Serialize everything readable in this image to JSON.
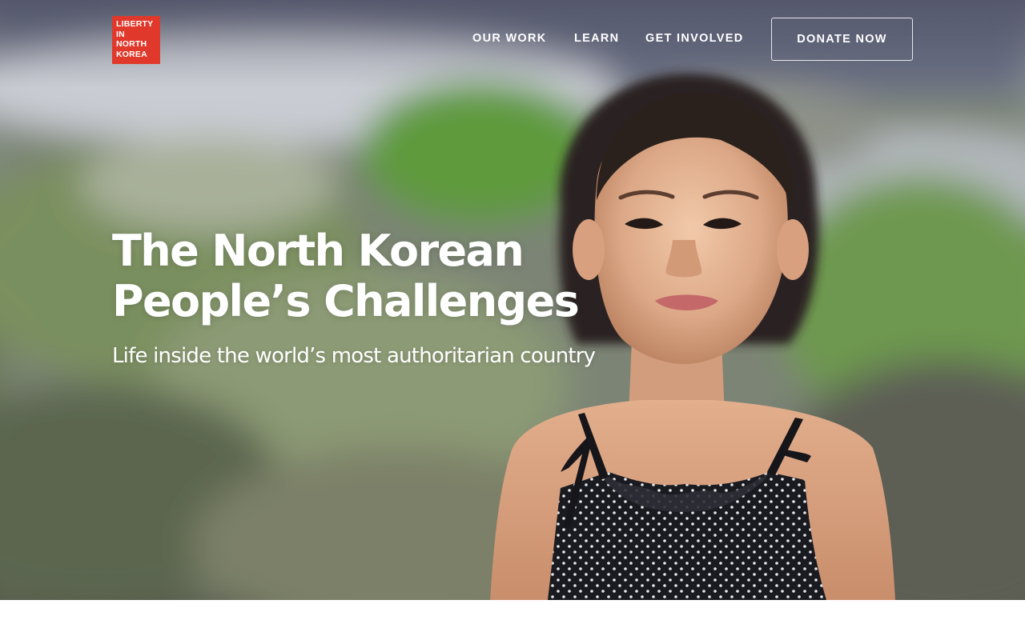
{
  "logo": {
    "lines": [
      "LIBERTY",
      "IN",
      "NORTH",
      "KOREA"
    ],
    "color": "#e0392b"
  },
  "nav": {
    "items": [
      {
        "label": "OUR WORK"
      },
      {
        "label": "LEARN"
      },
      {
        "label": "GET INVOLVED"
      }
    ],
    "donate_label": "DONATE NOW"
  },
  "hero": {
    "title_lines": [
      "The North Korean",
      "People’s Challenges"
    ],
    "subtitle": "Life inside the world’s most authoritarian country",
    "image": "hero-photo-child-portrait"
  }
}
